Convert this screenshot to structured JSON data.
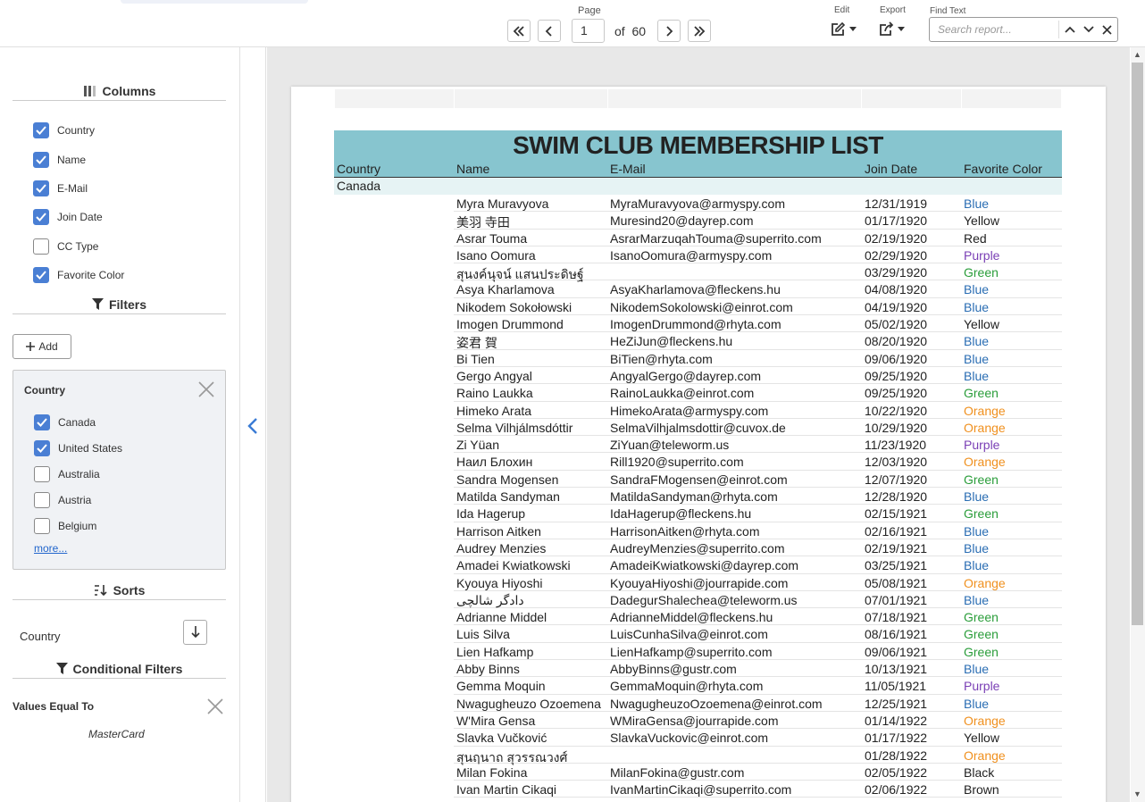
{
  "toolbar": {
    "page_label": "Page",
    "page_value": "1",
    "of_text": "of  60",
    "edit_label": "Edit",
    "export_label": "Export",
    "find_label": "Find Text",
    "search_placeholder": "Search report..."
  },
  "sidebar": {
    "columns_title": "Columns",
    "columns": [
      {
        "label": "Country",
        "checked": true
      },
      {
        "label": "Name",
        "checked": true
      },
      {
        "label": "E-Mail",
        "checked": true
      },
      {
        "label": "Join Date",
        "checked": true
      },
      {
        "label": "CC Type",
        "checked": false
      },
      {
        "label": "Favorite Color",
        "checked": true
      }
    ],
    "filters_title": "Filters",
    "add_label": "Add",
    "filter_card": {
      "title": "Country",
      "options": [
        {
          "label": "Canada",
          "checked": true
        },
        {
          "label": "United States",
          "checked": true
        },
        {
          "label": "Australia",
          "checked": false
        },
        {
          "label": "Austria",
          "checked": false
        },
        {
          "label": "Belgium",
          "checked": false
        }
      ],
      "more_label": "more..."
    },
    "sorts_title": "Sorts",
    "sort_field": "Country",
    "cond_title": "Conditional Filters",
    "cond_label": "Values Equal To",
    "cond_value": "MasterCard"
  },
  "report": {
    "title": "SWIM CLUB MEMBERSHIP LIST",
    "headers": {
      "country": "Country",
      "name": "Name",
      "email": "E-Mail",
      "join": "Join Date",
      "color": "Favorite Color"
    },
    "group": "Canada",
    "colors": {
      "Blue": "#2a6db3",
      "Yellow": "#222222",
      "Red": "#222222",
      "Purple": "#7a3fb5",
      "Green": "#2a9d3a",
      "Orange": "#f0901e",
      "Black": "#222222",
      "Brown": "#222222"
    },
    "rows": [
      [
        "Myra Muravyova",
        "MyraMuravyova@armyspy.com",
        "12/31/1919",
        "Blue"
      ],
      [
        "美羽 寺田",
        "Muresind20@dayrep.com",
        "01/17/1920",
        "Yellow"
      ],
      [
        "Asrar Touma",
        "AsrarMarzuqahTouma@superrito.com",
        "02/19/1920",
        "Red"
      ],
      [
        "Isano Oomura",
        "IsanoOomura@armyspy.com",
        "02/29/1920",
        "Purple"
      ],
      [
        "สุนงค์นุจน์ แสนประดิษฐ์",
        "",
        "03/29/1920",
        "Green"
      ],
      [
        "Asya Kharlamova",
        "AsyaKharlamova@fleckens.hu",
        "04/08/1920",
        "Blue"
      ],
      [
        "Nikodem Sokołowski",
        "NikodemSokolowski@einrot.com",
        "04/19/1920",
        "Blue"
      ],
      [
        "Imogen Drummond",
        "ImogenDrummond@rhyta.com",
        "05/02/1920",
        "Yellow"
      ],
      [
        "姿君 賀",
        "HeZiJun@fleckens.hu",
        "08/20/1920",
        "Blue"
      ],
      [
        "Bi Tien",
        "BiTien@rhyta.com",
        "09/06/1920",
        "Blue"
      ],
      [
        "Gergo Angyal",
        "AngyalGergo@dayrep.com",
        "09/25/1920",
        "Blue"
      ],
      [
        "Raino Laukka",
        "RainoLaukka@einrot.com",
        "09/25/1920",
        "Green"
      ],
      [
        "Himeko Arata",
        "HimekoArata@armyspy.com",
        "10/22/1920",
        "Orange"
      ],
      [
        "Selma Vilhjálmsdóttir",
        "SelmaVilhjalmsdottir@cuvox.de",
        "10/29/1920",
        "Orange"
      ],
      [
        "Zi Yüan",
        "ZiYuan@teleworm.us",
        "11/23/1920",
        "Purple"
      ],
      [
        "Наил Блохин",
        "Rill1920@superrito.com",
        "12/03/1920",
        "Orange"
      ],
      [
        "Sandra Mogensen",
        "SandraFMogensen@einrot.com",
        "12/07/1920",
        "Green"
      ],
      [
        "Matilda Sandyman",
        "MatildaSandyman@rhyta.com",
        "12/28/1920",
        "Blue"
      ],
      [
        "Ida Hagerup",
        "IdaHagerup@fleckens.hu",
        "02/15/1921",
        "Green"
      ],
      [
        "Harrison Aitken",
        "HarrisonAitken@rhyta.com",
        "02/16/1921",
        "Blue"
      ],
      [
        "Audrey Menzies",
        "AudreyMenzies@superrito.com",
        "02/19/1921",
        "Blue"
      ],
      [
        "Amadei Kwiatkowski",
        "AmadeiKwiatkowski@dayrep.com",
        "03/25/1921",
        "Blue"
      ],
      [
        "Kyouya Hiyoshi",
        "KyouyaHiyoshi@jourrapide.com",
        "05/08/1921",
        "Orange"
      ],
      [
        "دادگر شالچی",
        "DadegurShalechea@teleworm.us",
        "07/01/1921",
        "Blue"
      ],
      [
        "Adrianne Middel",
        "AdrianneMiddel@fleckens.hu",
        "07/18/1921",
        "Green"
      ],
      [
        "Luis Silva",
        "LuisCunhaSilva@einrot.com",
        "08/16/1921",
        "Green"
      ],
      [
        "Lien Hafkamp",
        "LienHafkamp@superrito.com",
        "09/06/1921",
        "Green"
      ],
      [
        "Abby Binns",
        "AbbyBinns@gustr.com",
        "10/13/1921",
        "Blue"
      ],
      [
        "Gemma Moquin",
        "GemmaMoquin@rhyta.com",
        "11/05/1921",
        "Purple"
      ],
      [
        "Nwagugheuzo Ozoemena",
        "NwagugheuzoOzoemena@einrot.com",
        "12/25/1921",
        "Blue"
      ],
      [
        "W'Mira Gensa",
        "WMiraGensa@jourrapide.com",
        "01/14/1922",
        "Orange"
      ],
      [
        "Slavka Vučković",
        "SlavkaVuckovic@einrot.com",
        "01/17/1922",
        "Yellow"
      ],
      [
        "สุนฤนาถ สุวรรณวงศ์",
        "",
        "01/28/1922",
        "Orange"
      ],
      [
        "Milan Fokina",
        "MilanFokina@gustr.com",
        "02/05/1922",
        "Black"
      ],
      [
        "Ivan Martin Cikaqi",
        "IvanMartinCikaqi@superrito.com",
        "02/06/1922",
        "Brown"
      ]
    ]
  }
}
